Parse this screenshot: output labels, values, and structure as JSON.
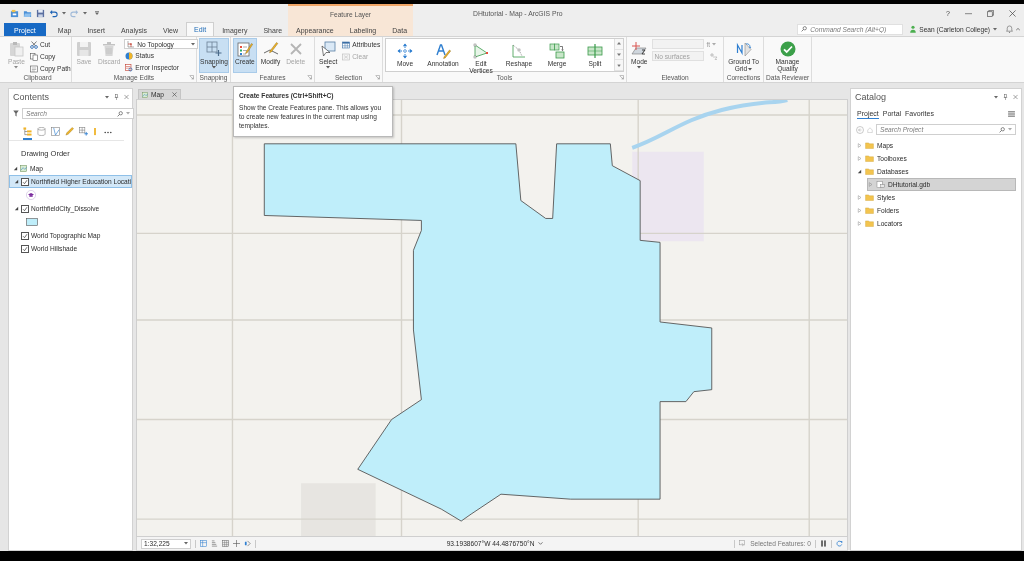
{
  "title_bar": {
    "title": "DHtutorial - Map - ArcGIS Pro",
    "help": "?"
  },
  "ribbon_tabs": [
    {
      "label": "Project",
      "kind": "file",
      "selected": false
    },
    {
      "label": "Map",
      "kind": "tab",
      "selected": false
    },
    {
      "label": "Insert",
      "kind": "tab",
      "selected": false
    },
    {
      "label": "Analysis",
      "kind": "tab",
      "selected": false
    },
    {
      "label": "View",
      "kind": "tab",
      "selected": false
    },
    {
      "label": "Edit",
      "kind": "tab",
      "selected": true
    },
    {
      "label": "Imagery",
      "kind": "tab",
      "selected": false
    },
    {
      "label": "Share",
      "kind": "tab",
      "selected": false
    }
  ],
  "contextual_tabs": {
    "title": "Feature Layer",
    "tabs": [
      {
        "label": "Appearance",
        "selected": false
      },
      {
        "label": "Labeling",
        "selected": false
      },
      {
        "label": "Data",
        "selected": false
      }
    ]
  },
  "command_search": {
    "placeholder": "Command Search (Alt+Q)"
  },
  "user": {
    "name": "Sean (Carleton College)"
  },
  "ribbon": {
    "clipboard": {
      "label": "Clipboard",
      "paste": {
        "label": "Paste",
        "disabled": true
      },
      "cut": {
        "label": "Cut",
        "disabled": false
      },
      "copy": {
        "label": "Copy",
        "disabled": false
      },
      "copy_path": {
        "label": "Copy Path",
        "disabled": false
      }
    },
    "manage_edits": {
      "label": "Manage Edits",
      "save": {
        "label": "Save",
        "disabled": true
      },
      "discard": {
        "label": "Discard",
        "disabled": true
      },
      "topology": {
        "value": "No Topology"
      },
      "status": {
        "label": "Status",
        "disabled": false
      },
      "error_inspector": {
        "label": "Error Inspector",
        "disabled": false
      }
    },
    "snapping": {
      "label": "Snapping",
      "snapping": {
        "label": "Snapping",
        "on": true
      }
    },
    "features": {
      "label": "Features",
      "create": {
        "label": "Create",
        "highlighted": true
      },
      "modify": {
        "label": "Modify",
        "disabled": false
      },
      "delete": {
        "label": "Delete",
        "disabled": true
      }
    },
    "selection": {
      "label": "Selection",
      "select": {
        "label": "Select",
        "disabled": false
      },
      "attributes": {
        "label": "Attributes",
        "disabled": false
      },
      "clear": {
        "label": "Clear",
        "disabled": true
      }
    },
    "tools": {
      "label": "Tools",
      "items": [
        {
          "label": "Move"
        },
        {
          "label": "Annotation"
        },
        {
          "label": "Edit Vertices"
        },
        {
          "label": "Reshape"
        },
        {
          "label": "Merge"
        },
        {
          "label": "Split"
        }
      ]
    },
    "elevation": {
      "label": "Elevation",
      "mode": {
        "label": "Mode"
      },
      "height_field": {
        "disabled": true
      },
      "unit": {
        "value": "ft",
        "disabled": true
      },
      "surface": {
        "placeholder": "No surfaces",
        "disabled": true
      }
    },
    "corrections": {
      "label": "Corrections",
      "ground_to_grid": {
        "label": "Ground To Grid"
      }
    },
    "data_reviewer": {
      "label": "Data Reviewer",
      "manage_quality": {
        "label": "Manage Quality"
      }
    }
  },
  "tooltip": {
    "title": "Create Features (Ctrl+Shift+C)",
    "text": "Show the Create Features pane.  This allows you to create new features in the current map using templates."
  },
  "contents": {
    "title": "Contents",
    "search": {
      "placeholder": "Search"
    },
    "views": [
      {
        "selected": true
      },
      {
        "selected": false
      },
      {
        "selected": false
      },
      {
        "selected": false
      },
      {
        "selected": false
      },
      {
        "selected": false
      }
    ],
    "heading": "Drawing Order",
    "tree": [
      {
        "label": "Map",
        "kind": "map",
        "expanded": true,
        "selected": false,
        "children": [
          {
            "label": "Northfield Higher Education Locati",
            "kind": "point_layer",
            "expanded": true,
            "checked": true,
            "selected": true
          },
          {
            "label": "NorthfieldCity_Dissolve",
            "kind": "polygon_layer",
            "expanded": true,
            "checked": true,
            "selected": false
          },
          {
            "label": "World Topographic Map",
            "kind": "basemap",
            "checked": true,
            "selected": false
          },
          {
            "label": "World Hillshade",
            "kind": "basemap",
            "checked": true,
            "selected": false
          }
        ]
      }
    ]
  },
  "map_view": {
    "tab": "Map",
    "scale": "1:32,225",
    "coordinates": "93.1938607°W 44.4876750°N",
    "selected_features": "Selected Features: 0"
  },
  "catalog": {
    "title": "Catalog",
    "tabs": [
      {
        "label": "Project",
        "selected": true
      },
      {
        "label": "Portal",
        "selected": false
      },
      {
        "label": "Favorites",
        "selected": false
      }
    ],
    "search": {
      "placeholder": "Search Project"
    },
    "tree": [
      {
        "label": "Maps",
        "expanded": false,
        "selected": false
      },
      {
        "label": "Toolboxes",
        "expanded": false,
        "selected": false
      },
      {
        "label": "Databases",
        "expanded": true,
        "selected": false,
        "children": [
          {
            "label": "DHtutorial.gdb",
            "expanded": false,
            "selected": true
          }
        ]
      },
      {
        "label": "Styles",
        "expanded": false,
        "selected": false
      },
      {
        "label": "Folders",
        "expanded": false,
        "selected": false
      },
      {
        "label": "Locators",
        "expanded": false,
        "selected": false
      }
    ]
  }
}
